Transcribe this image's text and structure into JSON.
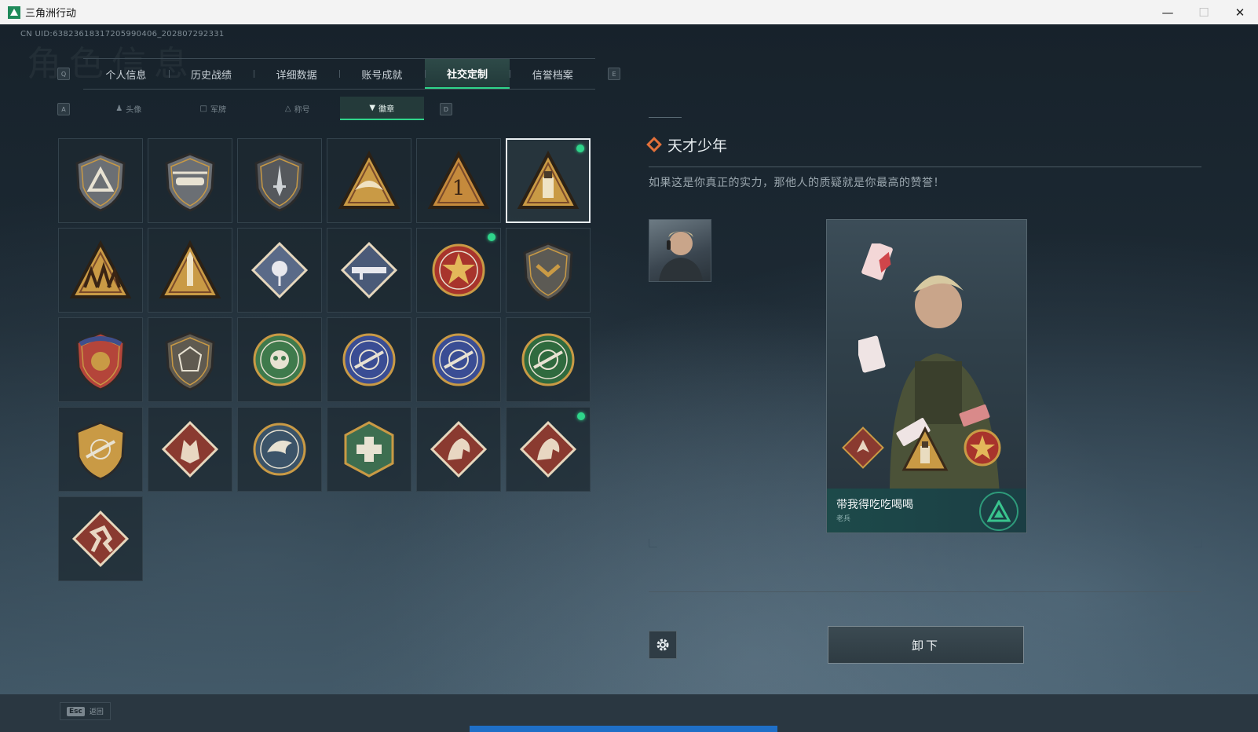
{
  "window": {
    "title": "三角洲行动",
    "minimize": "—",
    "maximize": "☐",
    "close": "✕"
  },
  "uid": "CN UID:63823618317205990406_202807292331",
  "background_title": "角色信息",
  "keys": {
    "tab_prev": "Q",
    "tab_next": "E",
    "sub_prev": "A",
    "sub_next": "D"
  },
  "tabs": [
    {
      "label": "个人信息"
    },
    {
      "label": "历史战绩"
    },
    {
      "label": "详细数据"
    },
    {
      "label": "账号成就"
    },
    {
      "label": "社交定制",
      "active": true
    },
    {
      "label": "信誉档案"
    }
  ],
  "subtabs": [
    {
      "label": "头像",
      "icon": "person-icon"
    },
    {
      "label": "军牌",
      "icon": "tag-icon"
    },
    {
      "label": "称号",
      "icon": "triangle-icon"
    },
    {
      "label": "徽章",
      "icon": "emblem-icon",
      "active": true
    }
  ],
  "badges": [
    {
      "id": "badge-delta-shield",
      "shape": "shield",
      "color": "#6b6f74",
      "glyph": "triangle"
    },
    {
      "id": "badge-helicopter",
      "shape": "shield",
      "color": "#6b6f74",
      "glyph": "heli"
    },
    {
      "id": "badge-dagger",
      "shape": "shield",
      "color": "#55585c",
      "glyph": "dagger"
    },
    {
      "id": "badge-gold-wing",
      "shape": "triangle",
      "color": "#c99a45",
      "glyph": "wing"
    },
    {
      "id": "badge-number-one",
      "shape": "triangle",
      "color": "#c58a3c",
      "glyph": "one"
    },
    {
      "id": "badge-usb",
      "shape": "triangle",
      "color": "#c99a45",
      "glyph": "usb",
      "selected": true,
      "equipped": true
    },
    {
      "id": "badge-soldiers",
      "shape": "triangle",
      "color": "#c99a45",
      "glyph": "soldiers"
    },
    {
      "id": "badge-rocket",
      "shape": "triangle",
      "color": "#c99a45",
      "glyph": "rocket"
    },
    {
      "id": "badge-rose",
      "shape": "diamond",
      "color": "#5a6a88",
      "glyph": "rose"
    },
    {
      "id": "badge-launcher",
      "shape": "diamond",
      "color": "#4a5a78",
      "glyph": "launcher"
    },
    {
      "id": "badge-star-medal",
      "shape": "circle",
      "color": "#a8342c",
      "glyph": "star",
      "equipped": true
    },
    {
      "id": "badge-dark-shield",
      "shape": "shield",
      "color": "#5c5a54",
      "glyph": "chevron"
    },
    {
      "id": "badge-blue-crest",
      "shape": "shield",
      "color": "#b4453a",
      "glyph": "crest"
    },
    {
      "id": "badge-hex-gem",
      "shape": "shield",
      "color": "#5f5a50",
      "glyph": "gem"
    },
    {
      "id": "badge-green-mask",
      "shape": "circle",
      "color": "#3f7a4c",
      "glyph": "mask"
    },
    {
      "id": "badge-blue-rifle",
      "shape": "circle",
      "color": "#3a4d94",
      "glyph": "rifle"
    },
    {
      "id": "badge-blue-rifle-2",
      "shape": "circle",
      "color": "#3a4d94",
      "glyph": "rifle"
    },
    {
      "id": "badge-green-rifle",
      "shape": "circle",
      "color": "#2f6a3e",
      "glyph": "rifle"
    },
    {
      "id": "badge-gold-sniper",
      "shape": "shield",
      "color": "#c99a45",
      "glyph": "rifle"
    },
    {
      "id": "badge-wolf",
      "shape": "diamond",
      "color": "#8a3a30",
      "glyph": "wolf"
    },
    {
      "id": "badge-eagle",
      "shape": "circle",
      "color": "#3b5368",
      "glyph": "eagle"
    },
    {
      "id": "badge-medic",
      "shape": "hexagon",
      "color": "#3d6e50",
      "glyph": "medic"
    },
    {
      "id": "badge-dragon",
      "shape": "diamond",
      "color": "#8a3a30",
      "glyph": "dragon"
    },
    {
      "id": "badge-dragon-2",
      "shape": "diamond",
      "color": "#8a3a30",
      "glyph": "dragon",
      "equipped": true
    },
    {
      "id": "badge-runner",
      "shape": "diamond",
      "color": "#8a3a30",
      "glyph": "runner"
    }
  ],
  "detail": {
    "title": "天才少年",
    "description": "如果这是你真正的实力，那他人的质疑就是你最高的赞誉！",
    "card_name": "带我得吃吃喝喝",
    "card_rank": "老兵"
  },
  "actions": {
    "unequip": "卸下"
  },
  "footer": {
    "esc_key": "Esc",
    "esc_label": "返回"
  },
  "colors": {
    "accent": "#2fd58b",
    "highlight": "#e2703a"
  }
}
